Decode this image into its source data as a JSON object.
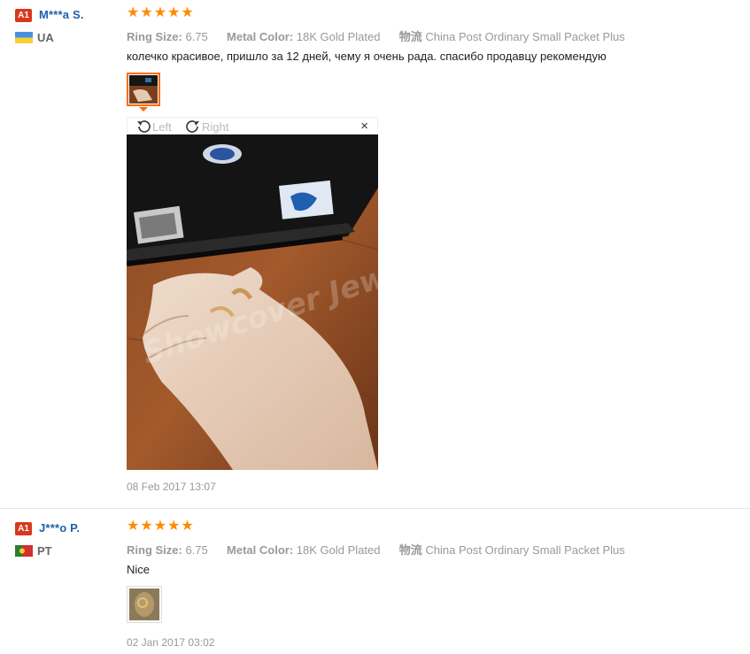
{
  "reviews": [
    {
      "level_badge": "A1",
      "username": "M***a S.",
      "country": "UA",
      "rating": 5,
      "ring_size_label": "Ring Size:",
      "ring_size_value": "6.75",
      "metal_color_label": "Metal Color:",
      "metal_color_value": "18K Gold Plated",
      "shipping_icon": "物流",
      "shipping_value": "China Post Ordinary Small Packet Plus",
      "text": "колечко красивое, пришло за 12 дней, чему я очень рада. спасибо продавцу рекомендую",
      "viewer": {
        "rotate_left_label": "Left",
        "rotate_right_label": "Right",
        "close_label": "×",
        "watermark": "Showcover Jewelry"
      },
      "date": "08 Feb 2017 13:07"
    },
    {
      "level_badge": "A1",
      "username": "J***o P.",
      "country": "PT",
      "rating": 5,
      "ring_size_label": "Ring Size:",
      "ring_size_value": "6.75",
      "metal_color_label": "Metal Color:",
      "metal_color_value": "18K Gold Plated",
      "shipping_icon": "物流",
      "shipping_value": "China Post Ordinary Small Packet Plus",
      "text": "Nice",
      "date": "02 Jan 2017 03:02"
    }
  ],
  "colors": {
    "star": "#ff8a00",
    "username": "#1a61b0",
    "badge": "#d9381e",
    "thumb_active_border": "#ff6a00"
  },
  "icons": {
    "star": "★",
    "flag_ua": "ua-flag-icon",
    "flag_pt": "pt-flag-icon",
    "rotate_left": "rotate-left-icon",
    "rotate_right": "rotate-right-icon",
    "close": "close-icon"
  }
}
